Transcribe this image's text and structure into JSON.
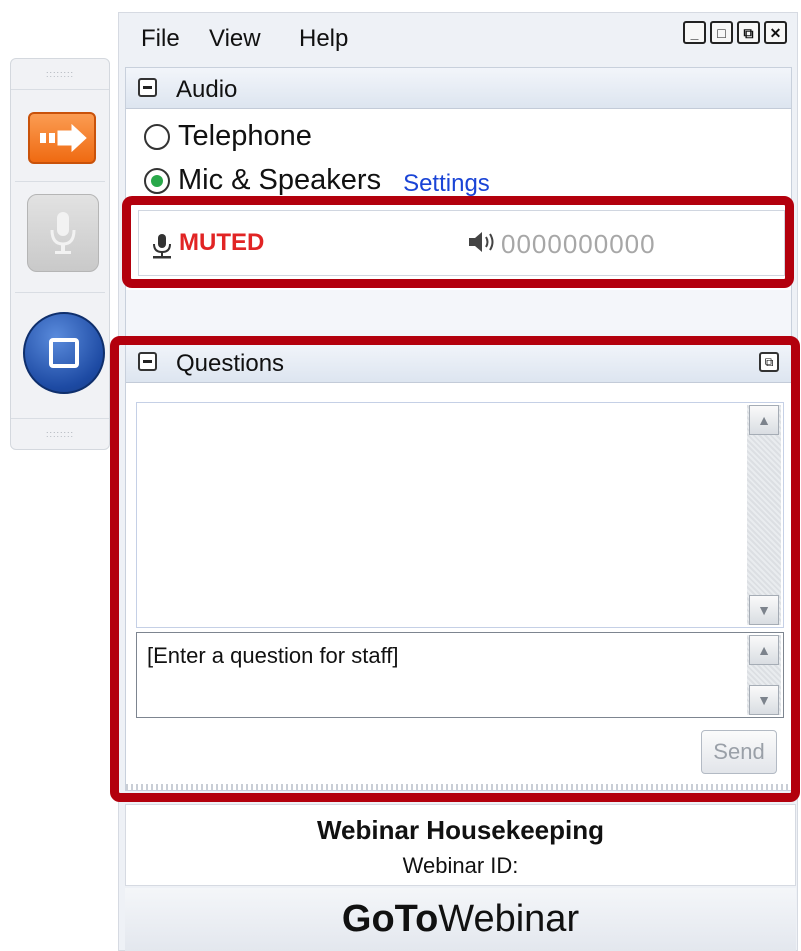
{
  "menu": {
    "file": "File",
    "view": "View",
    "help": "Help"
  },
  "window_buttons": {
    "minimize": "_",
    "maximize": "□",
    "restore": "⧉",
    "close": "✕"
  },
  "audio": {
    "title": "Audio",
    "options": [
      {
        "label": "Telephone",
        "selected": false
      },
      {
        "label": "Mic & Speakers",
        "selected": true
      }
    ],
    "settings_link": "Settings",
    "status": "MUTED",
    "level_meter": "0000000000"
  },
  "questions": {
    "title": "Questions",
    "input_placeholder": "[Enter a question for staff]",
    "send_label": "Send"
  },
  "info": {
    "title": "Webinar Housekeeping",
    "webinar_id_label": "Webinar ID:"
  },
  "brand": {
    "bold": "GoTo",
    "rest": "Webinar"
  },
  "colors": {
    "accent_orange": "#ef6a12",
    "stop_blue": "#1d4aa3",
    "muted_red": "#e12424",
    "highlight_red": "#b3000d",
    "link_blue": "#1a44d6"
  },
  "icons": [
    "grip-icon",
    "arrow-icon",
    "microphone-icon",
    "stop-icon",
    "speaker-icon",
    "collapse-icon",
    "popout-icon",
    "scroll-up-icon",
    "scroll-down-icon"
  ]
}
